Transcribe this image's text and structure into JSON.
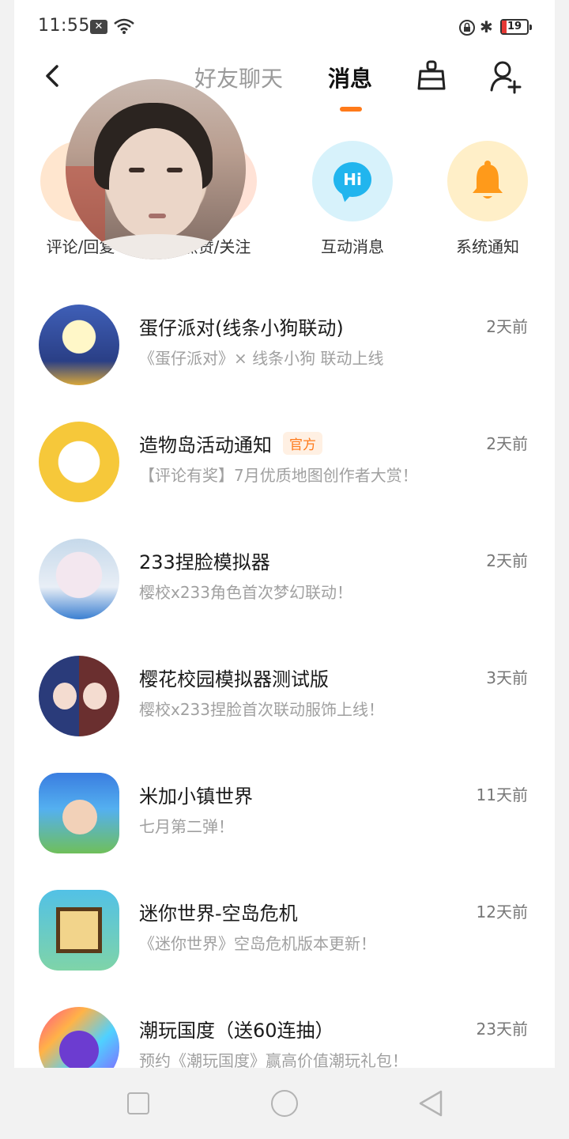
{
  "status_bar": {
    "time": "11:55",
    "battery": "19",
    "icons": [
      "x-notification-icon",
      "wifi-icon",
      "rotation-lock-icon",
      "bluetooth-icon",
      "battery-icon"
    ]
  },
  "header": {
    "tabs": [
      {
        "label": "好友聊天",
        "active": false
      },
      {
        "label": "消息",
        "active": true
      }
    ],
    "icons": [
      "back-icon",
      "cleanup-icon",
      "add-friend-icon"
    ],
    "accent_color": "#ff7a1a"
  },
  "quick_entries": [
    {
      "label": "评论/回复",
      "icon": "comment-icon"
    },
    {
      "label": "点赞/关注",
      "icon": "like-icon"
    },
    {
      "label": "互动消息",
      "icon": "hi-bubble-icon",
      "icon_text": "Hi"
    },
    {
      "label": "系统通知",
      "icon": "bell-icon"
    }
  ],
  "messages": [
    {
      "name": "蛋仔派对(线条小狗联动)",
      "preview": "《蛋仔派对》× 线条小狗 联动上线",
      "time": "2天前",
      "badge": ""
    },
    {
      "name": "造物岛活动通知",
      "preview": "【评论有奖】7月优质地图创作者大赏！",
      "time": "2天前",
      "badge": "官方"
    },
    {
      "name": "233捏脸模拟器",
      "preview": "樱校x233角色首次梦幻联动！",
      "time": "2天前",
      "badge": ""
    },
    {
      "name": "樱花校园模拟器测试版",
      "preview": "樱校x233捏脸首次联动服饰上线！",
      "time": "3天前",
      "badge": ""
    },
    {
      "name": "米加小镇世界",
      "preview": "七月第二弹！",
      "time": "11天前",
      "badge": ""
    },
    {
      "name": "迷你世界-空岛危机",
      "preview": "《迷你世界》空岛危机版本更新！",
      "time": "12天前",
      "badge": ""
    },
    {
      "name": "潮玩国度（送60连抽）",
      "preview": "预约《潮玩国度》赢高价值潮玩礼包！",
      "time": "23天前",
      "badge": ""
    }
  ],
  "nav_bar": {
    "icons": [
      "recent-apps-icon",
      "home-icon",
      "back-triangle-icon"
    ]
  }
}
